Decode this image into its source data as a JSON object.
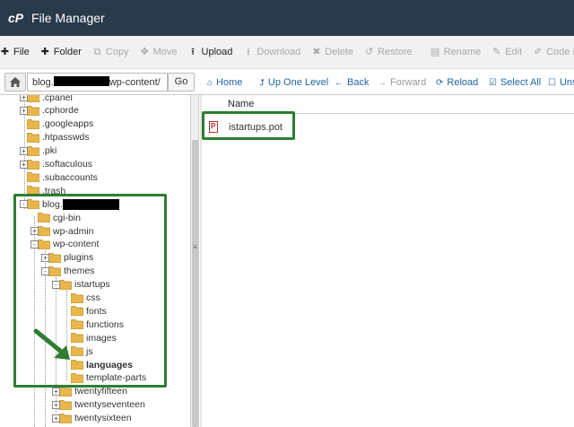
{
  "header": {
    "title": "File Manager",
    "logo_text": "cP"
  },
  "toolbar": {
    "items": [
      {
        "label": "File",
        "icon": "plus-icon",
        "enabled": true
      },
      {
        "label": "Folder",
        "icon": "plus-icon",
        "enabled": true
      },
      {
        "label": "Copy",
        "icon": "copy-icon",
        "enabled": false
      },
      {
        "label": "Move",
        "icon": "move-icon",
        "enabled": false
      },
      {
        "label": "Upload",
        "icon": "upload-icon",
        "enabled": true
      },
      {
        "label": "Download",
        "icon": "download-icon",
        "enabled": false
      },
      {
        "label": "Delete",
        "icon": "delete-icon",
        "enabled": false
      },
      {
        "label": "Restore",
        "icon": "restore-icon",
        "enabled": false
      },
      {
        "label": "Rename",
        "icon": "rename-icon",
        "enabled": false
      },
      {
        "label": "Edit",
        "icon": "edit-icon",
        "enabled": false
      },
      {
        "label": "Code Edit",
        "icon": "code-edit-icon",
        "enabled": false
      }
    ]
  },
  "address": {
    "path_prefix": "blog.",
    "path_suffix": "wp-content/",
    "go_label": "Go"
  },
  "nav": {
    "home": "Home",
    "up": "Up One Level",
    "back": "Back",
    "forward": "Forward",
    "reload": "Reload",
    "select_all": "Select All",
    "unselect": "Unse"
  },
  "tree": {
    "items": [
      {
        "label": ".cpanel",
        "expand": "+"
      },
      {
        "label": ".cphorde",
        "expand": "+"
      },
      {
        "label": ".googleapps",
        "expand": ""
      },
      {
        "label": ".htpasswds",
        "expand": ""
      },
      {
        "label": ".pki",
        "expand": "+"
      },
      {
        "label": ".softaculous",
        "expand": "+"
      },
      {
        "label": ".subaccounts",
        "expand": ""
      },
      {
        "label": ".trash",
        "expand": ""
      },
      {
        "label": "blog.",
        "expand": "-"
      },
      {
        "label": "cgi-bin",
        "expand": ""
      },
      {
        "label": "wp-admin",
        "expand": "+"
      },
      {
        "label": "wp-content",
        "expand": "-"
      },
      {
        "label": "plugins",
        "expand": "+"
      },
      {
        "label": "themes",
        "expand": "-"
      },
      {
        "label": "istartups",
        "expand": "-"
      },
      {
        "label": "css",
        "expand": ""
      },
      {
        "label": "fonts",
        "expand": ""
      },
      {
        "label": "functions",
        "expand": ""
      },
      {
        "label": "images",
        "expand": ""
      },
      {
        "label": "js",
        "expand": ""
      },
      {
        "label": "languages",
        "expand": ""
      },
      {
        "label": "template-parts",
        "expand": ""
      },
      {
        "label": "twentyfifteen",
        "expand": "+"
      },
      {
        "label": "twentyseventeen",
        "expand": "+"
      },
      {
        "label": "twentysixteen",
        "expand": "+"
      }
    ]
  },
  "files": {
    "column_name": "Name",
    "rows": [
      {
        "name": "istartups.pot"
      }
    ]
  },
  "colors": {
    "header_bg": "#293a4a",
    "link": "#1f65a6",
    "highlight": "#2e7d32",
    "folder": "#e8b64a"
  }
}
